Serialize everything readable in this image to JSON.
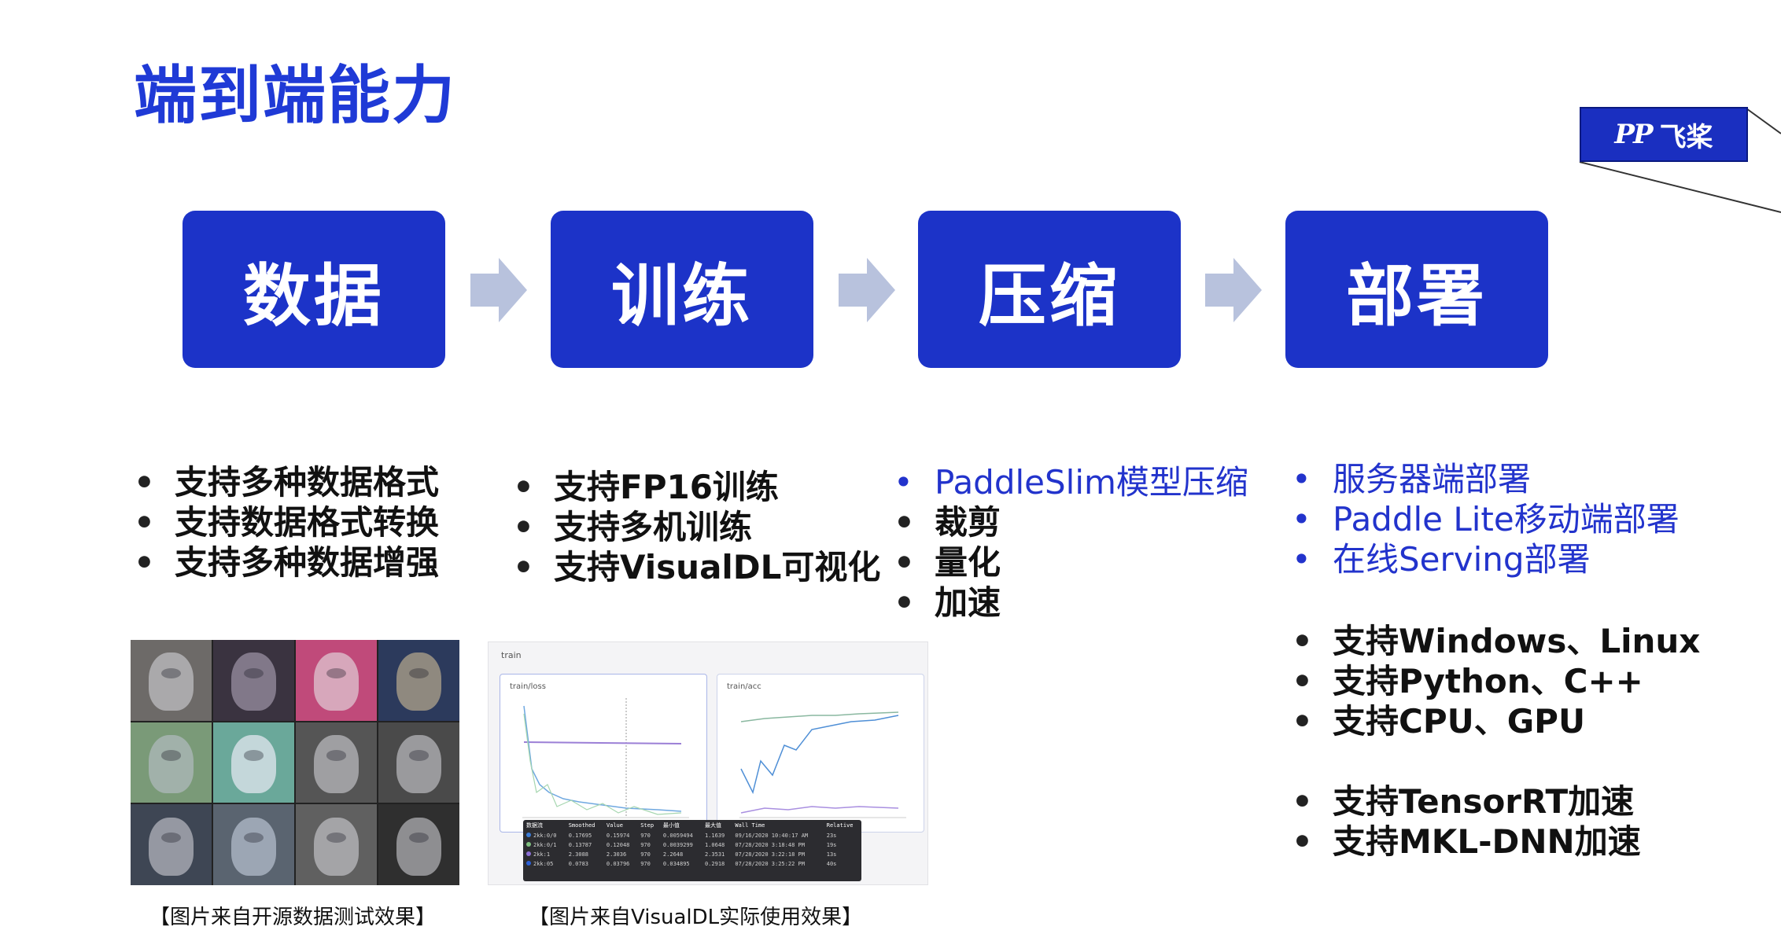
{
  "slide": {
    "title": "端到端能力",
    "logo_text": "飞桨",
    "logo_mark": "PP"
  },
  "stages": [
    {
      "label": "数据"
    },
    {
      "label": "训练"
    },
    {
      "label": "压缩"
    },
    {
      "label": "部署"
    }
  ],
  "data_features": [
    "支持多种数据格式",
    "支持数据格式转换",
    "支持多种数据增强"
  ],
  "train_features": [
    "支持FP16训练",
    "支持多机训练",
    "支持VisualDL可视化"
  ],
  "compress_features": {
    "highlight": [
      "PaddleSlim模型压缩"
    ],
    "items": [
      "裁剪",
      "量化",
      "加速"
    ]
  },
  "deploy_features": {
    "highlight": [
      "服务器端部署",
      "Paddle Lite移动端部署",
      "在线Serving部署"
    ],
    "platforms": [
      "支持Windows、Linux",
      "支持Python、C++",
      "支持CPU、GPU"
    ],
    "acceleration": [
      "支持TensorRT加速",
      "支持MKL-DNN加速"
    ]
  },
  "captions": {
    "data_image": "【图片来自开源数据测试效果】",
    "visualdl_image": "【图片来自VisualDL实际使用效果】"
  },
  "visualdl": {
    "section_label": "train",
    "panels": [
      {
        "title": "train/loss"
      },
      {
        "title": "train/acc"
      }
    ],
    "table_headers": [
      "数据流",
      "Smoothed",
      "Value",
      "Step",
      "最小值",
      "最大值",
      "Wall Time",
      "Relative"
    ],
    "table_rows": [
      {
        "color": "#3b7bd6",
        "cells": [
          "2kk:0/0",
          "0.17695",
          "0.15974",
          "970",
          "0.0059494",
          "1.1639",
          "09/16/2020 10:40:17 AM",
          "23s"
        ]
      },
      {
        "color": "#7fbf7f",
        "cells": [
          "2kk:0/1",
          "0.13787",
          "0.12048",
          "970",
          "0.0039299",
          "1.0648",
          "07/28/2020 3:18:48 PM",
          "19s"
        ]
      },
      {
        "color": "#8c6fd6",
        "cells": [
          "2kk:1",
          "2.3088",
          "2.3036",
          "970",
          "2.2648",
          "2.3531",
          "07/28/2020 3:22:18 PM",
          "13s"
        ]
      },
      {
        "color": "#2b5fd6",
        "cells": [
          "2kk:05",
          "0.0783",
          "0.03796",
          "970",
          "0.034895",
          "0.2918",
          "07/28/2020 3:25:22 PM",
          "40s"
        ]
      }
    ]
  },
  "colors": {
    "brand_blue": "#1c33c8",
    "title_blue": "#1f3ad6",
    "highlight_blue": "#2233cc",
    "arrow": "#b8c2dd"
  }
}
